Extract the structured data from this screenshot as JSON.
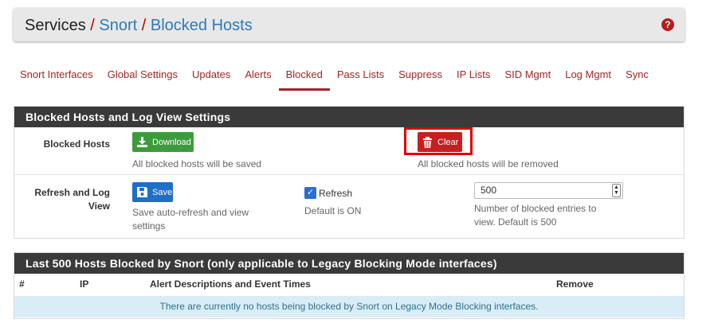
{
  "breadcrumb": {
    "root": "Services",
    "sep1": "/",
    "section": "Snort",
    "sep2": "/",
    "page": "Blocked Hosts"
  },
  "help_icon": "question-circle-icon",
  "tabs": [
    {
      "label": "Snort Interfaces"
    },
    {
      "label": "Global Settings"
    },
    {
      "label": "Updates"
    },
    {
      "label": "Alerts"
    },
    {
      "label": "Blocked",
      "active": true
    },
    {
      "label": "Pass Lists"
    },
    {
      "label": "Suppress"
    },
    {
      "label": "IP Lists"
    },
    {
      "label": "SID Mgmt"
    },
    {
      "label": "Log Mgmt"
    },
    {
      "label": "Sync"
    }
  ],
  "settings_panel": {
    "title": "Blocked Hosts and Log View Settings",
    "blocked_hosts": {
      "label": "Blocked Hosts",
      "download_label": "Download",
      "download_help": "All blocked hosts will be saved",
      "clear_label": "Clear",
      "clear_help": "All blocked hosts will be removed"
    },
    "refresh": {
      "label_line1": "Refresh and Log",
      "label_line2": "View",
      "save_label": "Save",
      "save_help_line1": "Save auto-refresh and view",
      "save_help_line2": "settings",
      "refresh_checkbox_label": "Refresh",
      "refresh_checked": true,
      "refresh_help": "Default is ON",
      "entries_value": "500",
      "entries_help_line1": "Number of blocked entries to",
      "entries_help_line2": "view. Default is 500"
    }
  },
  "blocked_panel": {
    "title": "Last 500 Hosts Blocked by Snort (only applicable to Legacy Blocking Mode interfaces)",
    "columns": [
      "#",
      "IP",
      "Alert Descriptions and Event Times",
      "Remove"
    ],
    "empty_message": "There are currently no hosts being blocked by Snort on Legacy Mode Blocking interfaces."
  },
  "colors": {
    "accent": "#a52323",
    "link": "#2c7ab8",
    "panel_heading": "#3a3a3a",
    "download": "#3c9c3c",
    "clear": "#c71f1f",
    "save": "#1e6fc5",
    "info_row": "#d9edf7"
  }
}
